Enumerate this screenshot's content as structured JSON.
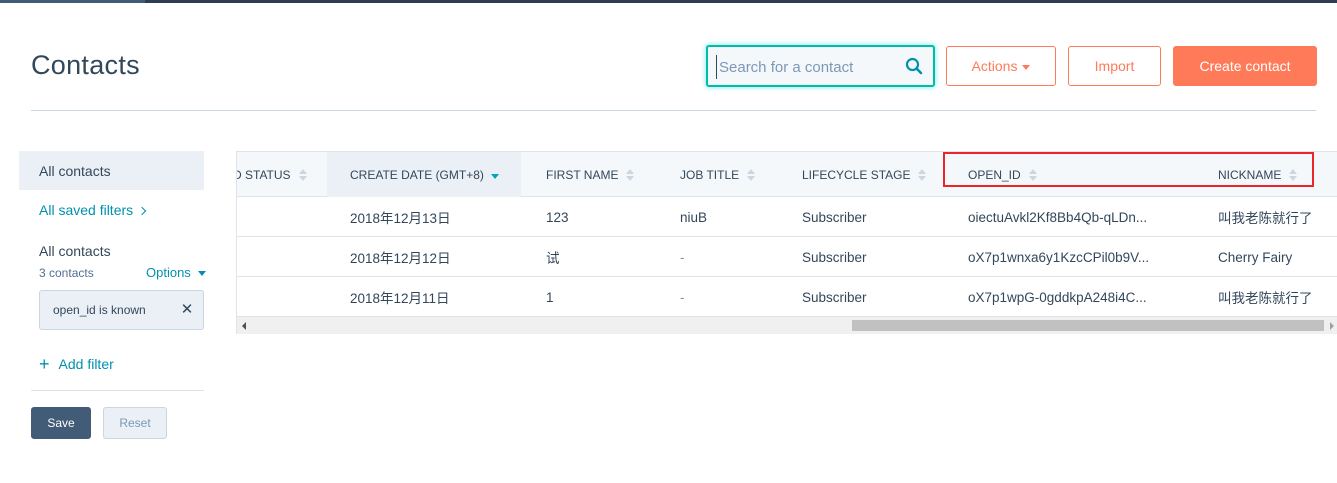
{
  "header": {
    "title": "Contacts",
    "search_placeholder": "Search for a contact",
    "actions_label": "Actions",
    "import_label": "Import",
    "create_label": "Create contact"
  },
  "sidebar": {
    "all_contacts": "All contacts",
    "saved_filters": "All saved filters",
    "view_name": "All contacts",
    "contact_count": "3 contacts",
    "options_label": "Options",
    "filter_chip": "open_id is known",
    "add_filter": "Add filter",
    "save_label": "Save",
    "reset_label": "Reset"
  },
  "table": {
    "columns": [
      "D STATUS",
      "CREATE DATE (GMT+8)",
      "FIRST NAME",
      "JOB TITLE",
      "LIFECYCLE STAGE",
      "OPEN_ID",
      "NICKNAME"
    ],
    "rows": [
      {
        "status": "",
        "create_date": "2018年12月13日",
        "first_name": "123",
        "job_title": "niuB",
        "lifecycle": "Subscriber",
        "open_id": "oiectuAvkl2Kf8Bb4Qb-qLDn...",
        "nickname": "叫我老陈就行了"
      },
      {
        "status": "",
        "create_date": "2018年12月12日",
        "first_name": "试",
        "job_title": "-",
        "lifecycle": "Subscriber",
        "open_id": "oX7p1wnxa6y1KzcCPil0b9V...",
        "nickname": "Cherry Fairy"
      },
      {
        "status": "",
        "create_date": "2018年12月11日",
        "first_name": "1",
        "job_title": "-",
        "lifecycle": "Subscriber",
        "open_id": "oX7p1wpG-0gddkpA248i4C...",
        "nickname": "叫我老陈就行了"
      }
    ]
  },
  "icons": {
    "search": "search-icon",
    "close": "close-icon",
    "plus": "plus-icon",
    "sort": "sort-icon"
  },
  "colors": {
    "accent": "#ff7a59",
    "link": "#0091ae",
    "highlight": "#e8262b",
    "text": "#33475b"
  }
}
